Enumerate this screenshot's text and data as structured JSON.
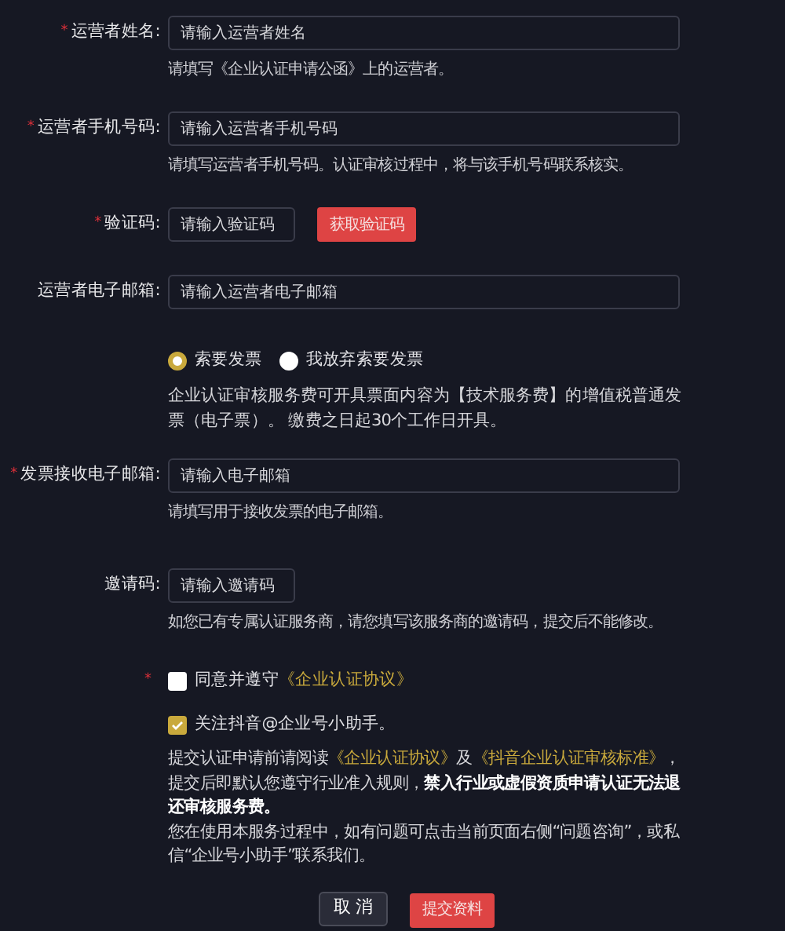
{
  "rows": [
    {
      "kind": "wide_input",
      "label": "运营者姓名:",
      "required_mark": "*",
      "placeholder": "请输入运营者姓名",
      "help": "请填写《企业认证申请公函》上的运营者。"
    },
    {
      "kind": "wide_input",
      "label": "运营者手机号码:",
      "required_mark": "*",
      "placeholder": "请输入运营者手机号码",
      "help": "请填写运营者手机号码。认证审核过程中，将与该手机号码联系核实。"
    },
    {
      "kind": "short_input",
      "label": "验证码:",
      "required_mark": "*",
      "placeholder": "请输入验证码",
      "button": "获取验证码"
    },
    {
      "kind": "wide_input",
      "label": "运营者电子邮箱:",
      "placeholder": "请输入运营者电子邮箱"
    },
    {
      "kind": "radios",
      "options": [
        {
          "label": "索要发票",
          "selected": true
        },
        {
          "label": "我放弃索要发票",
          "selected": false
        }
      ],
      "help": "企业认证审核服务费可开具票面内容为【技术服务费】的增值税普通发票（电子票）。 缴费之日起30个工作日开具。"
    },
    {
      "kind": "wide_input",
      "label": "发票接收电子邮箱:",
      "required_mark": "*",
      "placeholder": "请输入电子邮箱",
      "help": "请填写用于接收发票的电子邮箱。"
    },
    {
      "kind": "short_input",
      "label": "邀请码:",
      "placeholder": "请输入邀请码",
      "help": "如您已有专属认证服务商，请您填写该服务商的邀请码，提交后不能修改。"
    }
  ],
  "agreements": [
    {
      "required_mark": "*",
      "checked": false,
      "text": "同意并遵守",
      "link": "《企业认证协议》"
    },
    {
      "checked": true,
      "text": "关注抖音@企业号小助手。"
    }
  ],
  "notice": [
    [
      {
        "kind": "text",
        "text": "提交认证申请前请阅读"
      },
      {
        "kind": "link",
        "text": "《企业认证协议》"
      },
      {
        "kind": "text",
        "text": "及"
      },
      {
        "kind": "link",
        "text": "《抖音企业认证审核标准》"
      },
      {
        "kind": "text",
        "text": "，提交后即默认您遵守行业准入规则，"
      },
      {
        "kind": "bold",
        "text": "禁入行业或虚假资质申请认证无法退还审核服务费。"
      }
    ],
    [
      {
        "kind": "text",
        "text": "您在使用本服务过程中，如有问题可点击当前页面右侧“问题咨询”，或私信“企业号小助手”联系我们。"
      }
    ]
  ],
  "buttons": [
    {
      "label": "取 消",
      "kind": "secondary"
    },
    {
      "label": "提交资料",
      "kind": "primary"
    }
  ]
}
